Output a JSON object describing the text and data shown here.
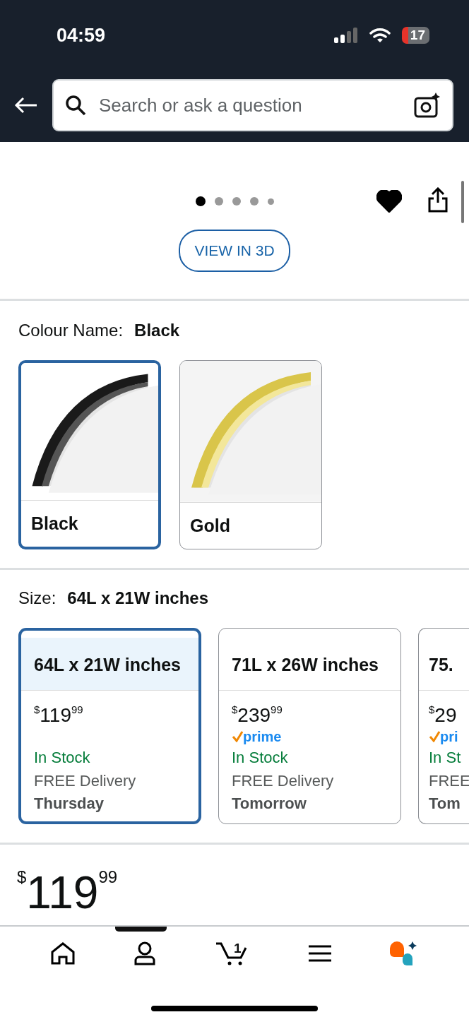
{
  "status_bar": {
    "time": "04:59",
    "battery": "17"
  },
  "search": {
    "placeholder": "Search or ask a question"
  },
  "gallery": {
    "dots": [
      {
        "selected": true
      },
      {
        "selected": false
      },
      {
        "selected": false
      },
      {
        "selected": false
      },
      {
        "selected": false
      }
    ],
    "favorited": true,
    "view_3d": "VIEW IN 3D"
  },
  "colour": {
    "label": "Colour Name:",
    "value": "Black",
    "options": [
      {
        "label": "Black",
        "selected": true,
        "kind": "black"
      },
      {
        "label": "Gold",
        "selected": false,
        "kind": "gold"
      }
    ]
  },
  "size": {
    "label": "Size:",
    "value": "64L x 21W inches",
    "options": [
      {
        "label": "64L x 21W inches",
        "selected": true,
        "currency": "$",
        "whole": "119",
        "fraction": "99",
        "stock": "In Stock",
        "delivery": "FREE Delivery",
        "day": "Thursday"
      },
      {
        "label": "71L x 26W inches",
        "selected": false,
        "currency": "$",
        "whole": "239",
        "fraction": "99",
        "prime": "prime",
        "stock": "In Stock",
        "delivery": "FREE Delivery",
        "day": "Tomorrow"
      },
      {
        "label": "75.",
        "selected": false,
        "currency": "$",
        "whole": "29",
        "prime": "pri",
        "stock": "In St",
        "delivery": "FREE",
        "day": "Tom",
        "cut": true
      }
    ]
  },
  "price": {
    "currency": "$",
    "whole": "119",
    "fraction": "99"
  },
  "bottom_nav": {
    "cart_count": "1"
  }
}
